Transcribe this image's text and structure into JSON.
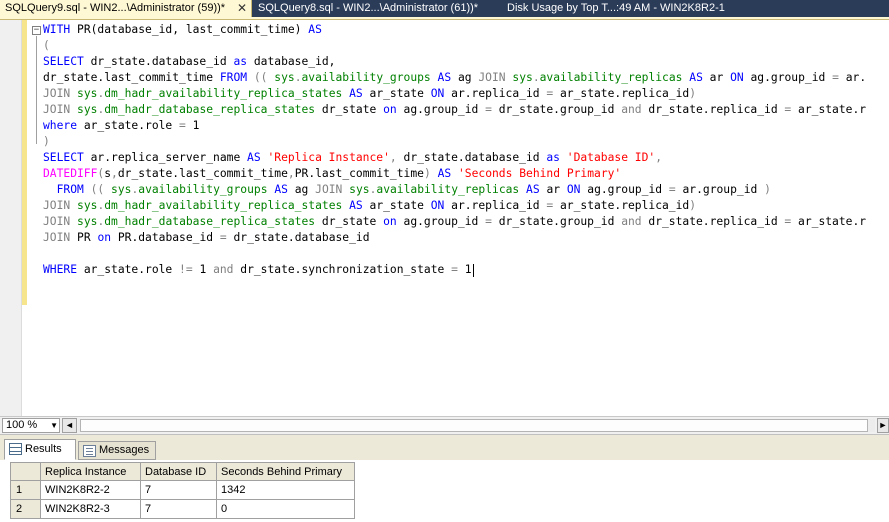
{
  "tabs": [
    {
      "label": "SQLQuery9.sql - WIN2...\\Administrator (59))*",
      "active": true
    },
    {
      "label": "SQLQuery8.sql - WIN2...\\Administrator (61))*",
      "active": false
    },
    {
      "label": "Disk Usage by Top T...:49 AM - WIN2K8R2-1",
      "active": false
    }
  ],
  "tab_close_icon": "close-icon",
  "editor": {
    "collapse_symbol": "−",
    "lines": [
      [
        [
          "kw",
          "WITH"
        ],
        [
          "t",
          " PR(database_id, last_commit_time) "
        ],
        [
          "kw",
          "AS"
        ]
      ],
      [
        [
          "gr",
          "("
        ]
      ],
      [
        [
          "kw",
          "SELECT"
        ],
        [
          "t",
          " dr_state.database_id "
        ],
        [
          "kw",
          "as"
        ],
        [
          "t",
          " database_id,"
        ]
      ],
      [
        [
          "t",
          "dr_state.last_commit_time "
        ],
        [
          "kw",
          "FROM"
        ],
        [
          "gr",
          " (( "
        ],
        [
          "sys",
          "sys"
        ],
        [
          "gr",
          "."
        ],
        [
          "sys",
          "availability_groups"
        ],
        [
          "t",
          " "
        ],
        [
          "kw",
          "AS"
        ],
        [
          "t",
          " ag "
        ],
        [
          "gr",
          "JOIN"
        ],
        [
          "t",
          " "
        ],
        [
          "sys",
          "sys"
        ],
        [
          "gr",
          "."
        ],
        [
          "sys",
          "availability_replicas"
        ],
        [
          "t",
          " "
        ],
        [
          "kw",
          "AS"
        ],
        [
          "t",
          " ar "
        ],
        [
          "kw",
          "ON"
        ],
        [
          "t",
          " ag.group_id "
        ],
        [
          "gr",
          "="
        ],
        [
          "t",
          " ar."
        ]
      ],
      [
        [
          "gr",
          "JOIN"
        ],
        [
          "t",
          " "
        ],
        [
          "sys",
          "sys"
        ],
        [
          "gr",
          "."
        ],
        [
          "sys",
          "dm_hadr_availability_replica_states"
        ],
        [
          "t",
          " "
        ],
        [
          "kw",
          "AS"
        ],
        [
          "t",
          " ar_state "
        ],
        [
          "kw",
          "ON"
        ],
        [
          "t",
          " ar.replica_id "
        ],
        [
          "gr",
          "="
        ],
        [
          "t",
          " ar_state.replica_id"
        ],
        [
          "gr",
          ")"
        ]
      ],
      [
        [
          "gr",
          "JOIN"
        ],
        [
          "t",
          " "
        ],
        [
          "sys",
          "sys"
        ],
        [
          "gr",
          "."
        ],
        [
          "sys",
          "dm_hadr_database_replica_states"
        ],
        [
          "t",
          " dr_state "
        ],
        [
          "kw",
          "on"
        ],
        [
          "t",
          " ag.group_id "
        ],
        [
          "gr",
          "="
        ],
        [
          "t",
          " dr_state.group_id "
        ],
        [
          "gr",
          "and"
        ],
        [
          "t",
          " dr_state.replica_id "
        ],
        [
          "gr",
          "="
        ],
        [
          "t",
          " ar_state.r"
        ]
      ],
      [
        [
          "kw",
          "where"
        ],
        [
          "t",
          " ar_state.role "
        ],
        [
          "gr",
          "="
        ],
        [
          "t",
          " 1"
        ]
      ],
      [
        [
          "gr",
          ")"
        ]
      ],
      [
        [
          "kw",
          "SELECT"
        ],
        [
          "t",
          " ar.replica_server_name "
        ],
        [
          "kw",
          "AS"
        ],
        [
          "t",
          " "
        ],
        [
          "str",
          "'Replica Instance'"
        ],
        [
          "gr",
          ","
        ],
        [
          "t",
          " dr_state.database_id "
        ],
        [
          "kw",
          "as"
        ],
        [
          "t",
          " "
        ],
        [
          "str",
          "'Database ID'"
        ],
        [
          "gr",
          ","
        ]
      ],
      [
        [
          "fn",
          "DATEDIFF"
        ],
        [
          "gr",
          "("
        ],
        [
          "t",
          "s"
        ],
        [
          "gr",
          ","
        ],
        [
          "t",
          "dr_state.last_commit_time"
        ],
        [
          "gr",
          ","
        ],
        [
          "t",
          "PR.last_commit_time"
        ],
        [
          "gr",
          ")"
        ],
        [
          "t",
          " "
        ],
        [
          "kw",
          "AS"
        ],
        [
          "t",
          " "
        ],
        [
          "str",
          "'Seconds Behind Primary'"
        ]
      ],
      [
        [
          "t",
          "  "
        ],
        [
          "kw",
          "FROM"
        ],
        [
          "gr",
          " (( "
        ],
        [
          "sys",
          "sys"
        ],
        [
          "gr",
          "."
        ],
        [
          "sys",
          "availability_groups"
        ],
        [
          "t",
          " "
        ],
        [
          "kw",
          "AS"
        ],
        [
          "t",
          " ag "
        ],
        [
          "gr",
          "JOIN"
        ],
        [
          "t",
          " "
        ],
        [
          "sys",
          "sys"
        ],
        [
          "gr",
          "."
        ],
        [
          "sys",
          "availability_replicas"
        ],
        [
          "t",
          " "
        ],
        [
          "kw",
          "AS"
        ],
        [
          "t",
          " ar "
        ],
        [
          "kw",
          "ON"
        ],
        [
          "t",
          " ag.group_id "
        ],
        [
          "gr",
          "="
        ],
        [
          "t",
          " ar.group_id "
        ],
        [
          "gr",
          ")"
        ]
      ],
      [
        [
          "gr",
          "JOIN"
        ],
        [
          "t",
          " "
        ],
        [
          "sys",
          "sys"
        ],
        [
          "gr",
          "."
        ],
        [
          "sys",
          "dm_hadr_availability_replica_states"
        ],
        [
          "t",
          " "
        ],
        [
          "kw",
          "AS"
        ],
        [
          "t",
          " ar_state "
        ],
        [
          "kw",
          "ON"
        ],
        [
          "t",
          " ar.replica_id "
        ],
        [
          "gr",
          "="
        ],
        [
          "t",
          " ar_state.replica_id"
        ],
        [
          "gr",
          ")"
        ]
      ],
      [
        [
          "gr",
          "JOIN"
        ],
        [
          "t",
          " "
        ],
        [
          "sys",
          "sys"
        ],
        [
          "gr",
          "."
        ],
        [
          "sys",
          "dm_hadr_database_replica_states"
        ],
        [
          "t",
          " dr_state "
        ],
        [
          "kw",
          "on"
        ],
        [
          "t",
          " ag.group_id "
        ],
        [
          "gr",
          "="
        ],
        [
          "t",
          " dr_state.group_id "
        ],
        [
          "gr",
          "and"
        ],
        [
          "t",
          " dr_state.replica_id "
        ],
        [
          "gr",
          "="
        ],
        [
          "t",
          " ar_state.r"
        ]
      ],
      [
        [
          "gr",
          "JOIN"
        ],
        [
          "t",
          " PR "
        ],
        [
          "kw",
          "on"
        ],
        [
          "t",
          " PR.database_id "
        ],
        [
          "gr",
          "="
        ],
        [
          "t",
          " dr_state.database_id"
        ]
      ],
      [],
      [
        [
          "kw",
          "WHERE"
        ],
        [
          "t",
          " ar_state.role "
        ],
        [
          "gr",
          "!="
        ],
        [
          "t",
          " 1 "
        ],
        [
          "gr",
          "and"
        ],
        [
          "t",
          " dr_state.synchronization_state "
        ],
        [
          "gr",
          "="
        ],
        [
          "t",
          " 1"
        ]
      ]
    ],
    "caret_line": 15
  },
  "zoom": {
    "value": "100 %",
    "arrow_icon": "dropdown-arrow-icon"
  },
  "scrollbar": {
    "left_icon": "◄",
    "right_icon": "►"
  },
  "result_tabs": [
    {
      "label": "Results",
      "icon": "results-grid-icon",
      "active": true
    },
    {
      "label": "Messages",
      "icon": "messages-icon",
      "active": false
    }
  ],
  "results": {
    "columns": [
      "Replica Instance",
      "Database ID",
      "Seconds Behind Primary"
    ],
    "rows": [
      {
        "num": "1",
        "cells": [
          "WIN2K8R2-2",
          "7",
          "1342"
        ]
      },
      {
        "num": "2",
        "cells": [
          "WIN2K8R2-3",
          "7",
          "0"
        ]
      }
    ]
  },
  "colors": {
    "tab_bar_bg": "#2b3c59",
    "active_tab_bg": "#fff8d4",
    "keyword": "#0000ff",
    "system_object": "#008000",
    "function": "#ff00ff",
    "string": "#ff0000",
    "operator": "#808080"
  }
}
